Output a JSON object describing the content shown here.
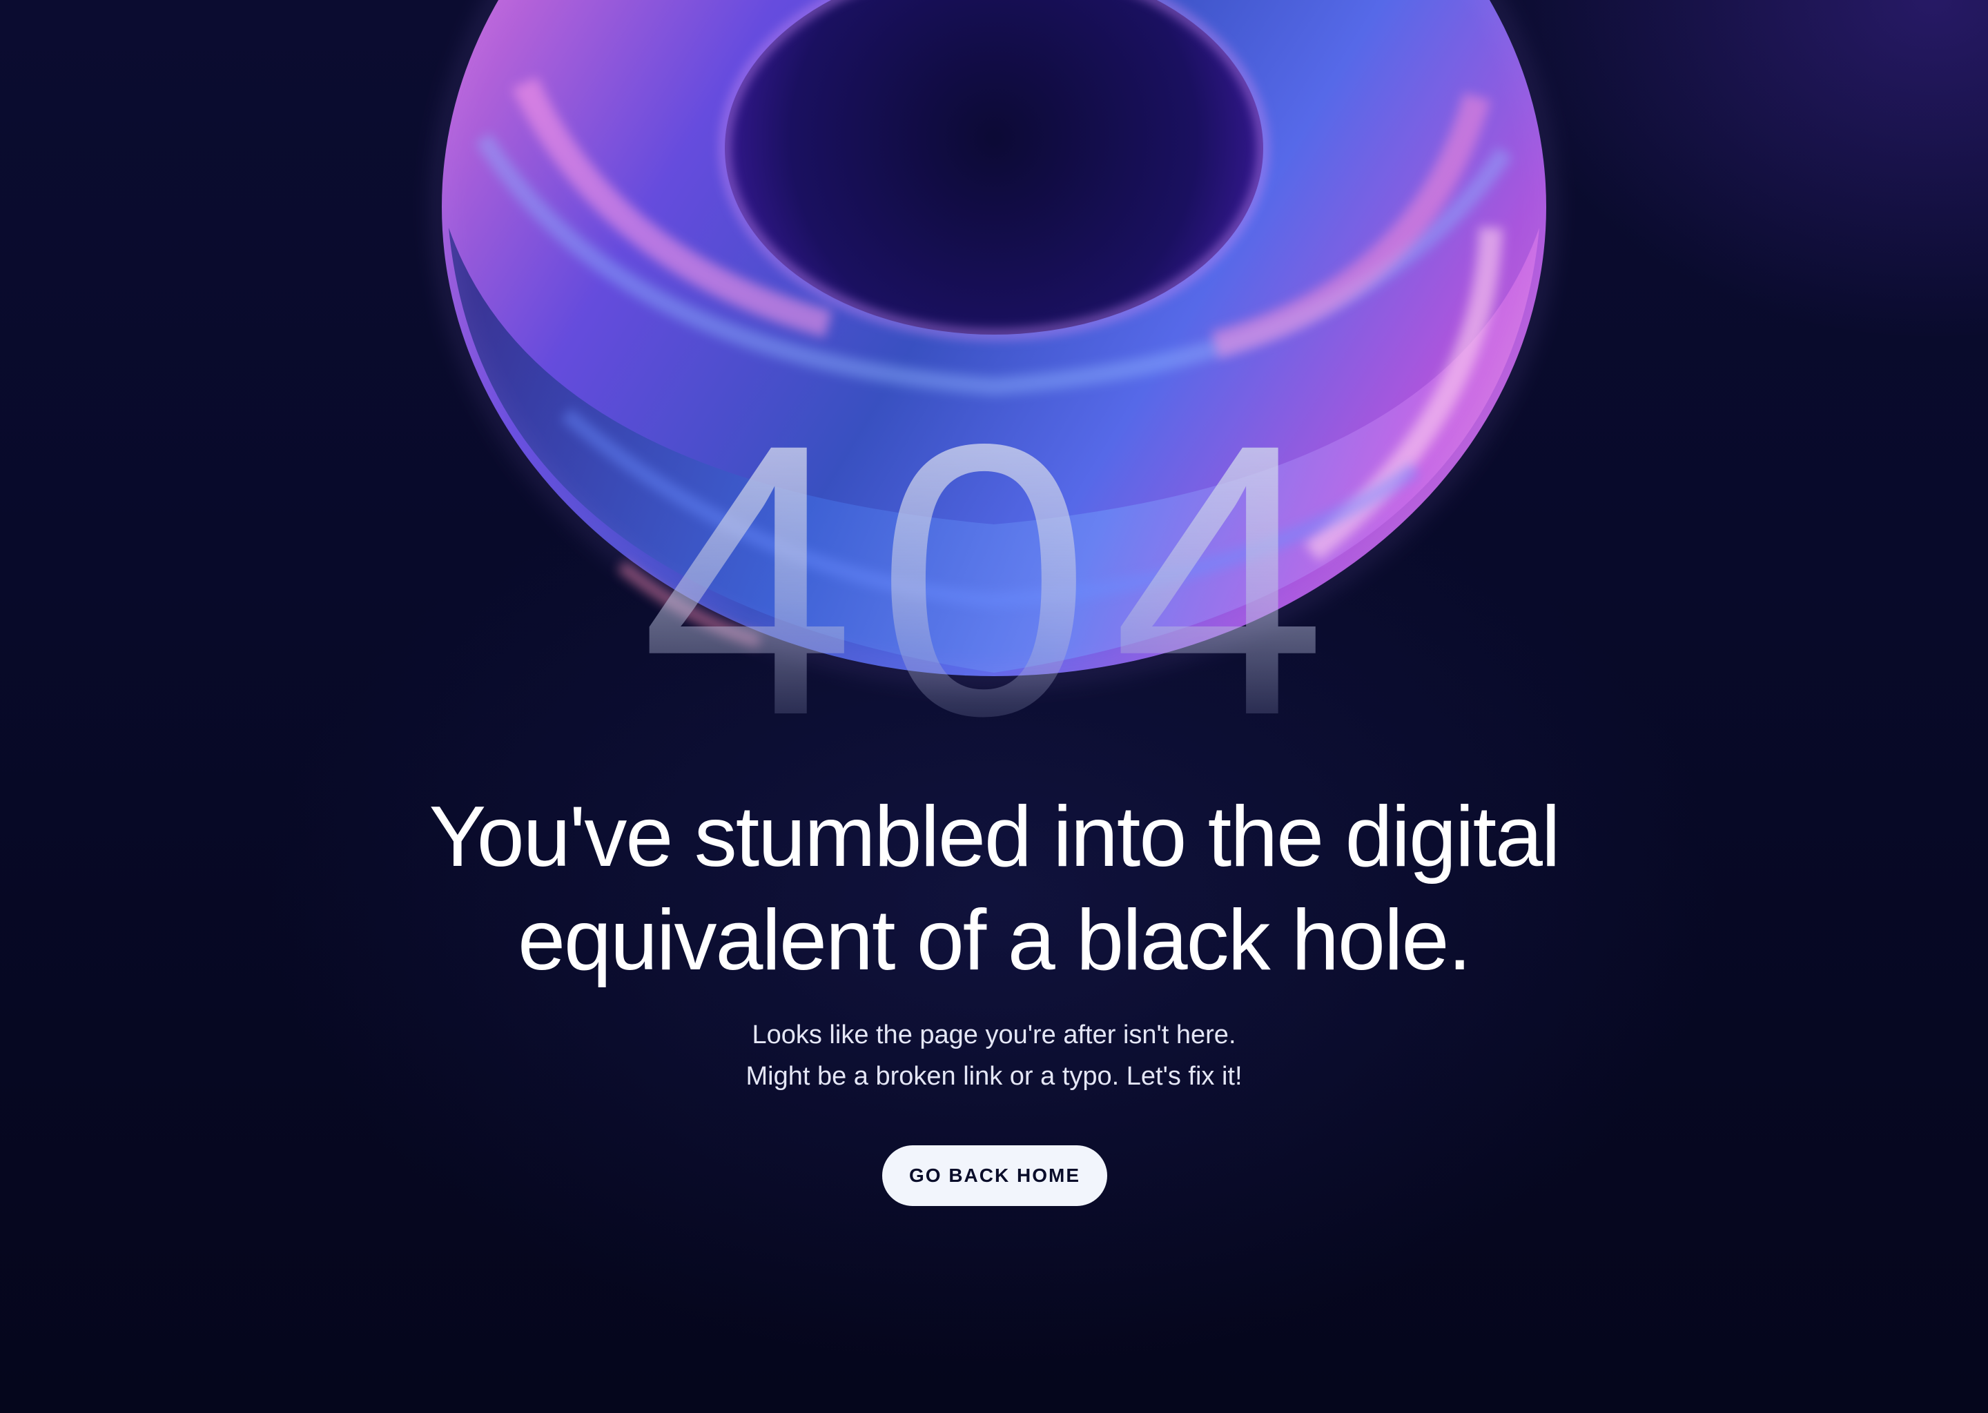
{
  "error": {
    "code": "404",
    "headline_line1": "You've stumbled into the digital",
    "headline_line2": "equivalent of a black hole.",
    "message_line1": "Looks like the page you're after isn't here.",
    "message_line2": "Might be a broken link or a typo. Let's fix it!"
  },
  "actions": {
    "home_button_label": "GO BACK HOME"
  },
  "colors": {
    "background": "#070a26",
    "button_bg": "#f2f5fc",
    "button_text": "#0a0d2a",
    "ring_pink": "#e46ad8",
    "ring_blue": "#4f6cf0",
    "ring_violet": "#7a3ae0"
  }
}
